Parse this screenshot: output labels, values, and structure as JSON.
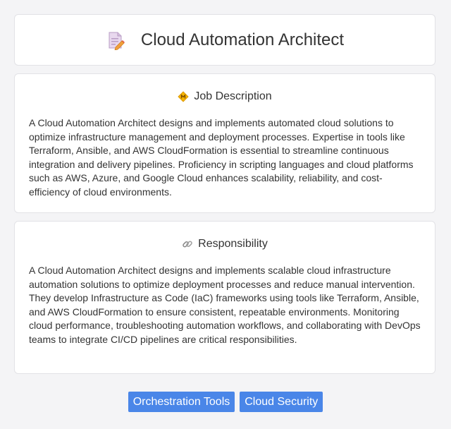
{
  "header": {
    "icon": "document-pencil-icon",
    "title": "Cloud Automation Architect"
  },
  "job_description": {
    "icon": "diamond-badge-icon",
    "title": "Job Description",
    "body": "A Cloud Automation Architect designs and implements automated cloud solutions to optimize infrastructure management and deployment processes. Expertise in tools like Terraform, Ansible, and AWS CloudFormation is essential to streamline continuous integration and delivery pipelines. Proficiency in scripting languages and cloud platforms such as AWS, Azure, and Google Cloud enhances scalability, reliability, and cost-efficiency of cloud environments."
  },
  "responsibility": {
    "icon": "link-icon",
    "title": "Responsibility",
    "body": "A Cloud Automation Architect designs and implements scalable cloud infrastructure automation solutions to optimize deployment processes and reduce manual intervention. They develop Infrastructure as Code (IaC) frameworks using tools like Terraform, Ansible, and AWS CloudFormation to ensure consistent, repeatable environments. Monitoring cloud performance, troubleshooting automation workflows, and collaborating with DevOps teams to integrate CI/CD pipelines are critical responsibilities."
  },
  "tags": [
    "Orchestration Tools",
    "Cloud Security"
  ],
  "colors": {
    "tag_background": "#4a86e8",
    "page_background": "#f4f4f6"
  }
}
